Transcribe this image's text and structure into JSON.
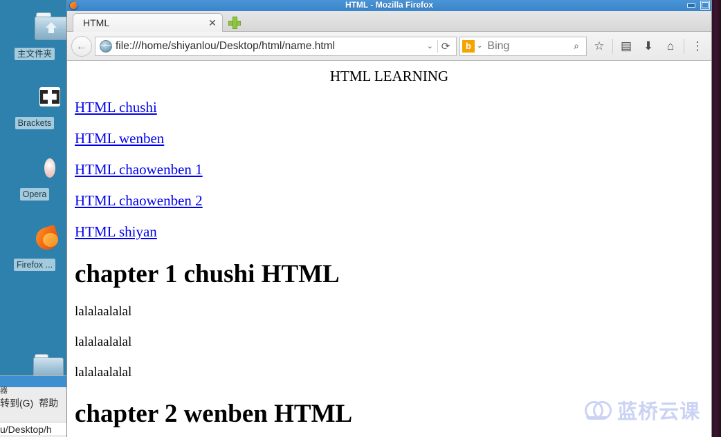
{
  "desktop": {
    "background_color": "#2e81ac",
    "icons": [
      {
        "name": "home-folder",
        "label": "主文件夹",
        "icon": "folder-home-icon"
      },
      {
        "name": "brackets",
        "label": "Brackets",
        "icon": "brackets-app-icon"
      },
      {
        "name": "opera",
        "label": "Opera",
        "icon": "opera-app-icon"
      },
      {
        "name": "firefox",
        "label": "Firefox ...",
        "icon": "firefox-app-icon"
      }
    ]
  },
  "file_manager": {
    "title_fragment": "器",
    "menu_fragments": [
      "转到(G)",
      "帮助"
    ],
    "path_fragment": "u/Desktop/h"
  },
  "browser": {
    "window_title": "HTML - Mozilla Firefox",
    "window_buttons": {
      "minimize": "minimize-icon",
      "maximize": "maximize-icon"
    },
    "tab": {
      "label": "HTML",
      "close_label": "✕",
      "new_tab_label": "+"
    },
    "toolbar": {
      "back_label": "←",
      "url_value": "file:///home/shiyanlou/Desktop/html/name.html",
      "url_dropdown_label": "⌄",
      "reload_label": "⟳",
      "search_engine": "Bing",
      "search_engine_initial": "b",
      "search_engine_color": "#f5a300",
      "search_placeholder": "Bing",
      "search_value": "",
      "search_go_label": "⌕",
      "icons": [
        {
          "name": "bookmark-star-icon",
          "glyph": "☆"
        },
        {
          "name": "library-icon",
          "glyph": "▤"
        },
        {
          "name": "downloads-icon",
          "glyph": "⬇"
        },
        {
          "name": "home-icon",
          "glyph": "⌂"
        },
        {
          "name": "menu-icon",
          "glyph": "⋮"
        }
      ]
    }
  },
  "page": {
    "header": "HTML LEARNING",
    "links": [
      "HTML chushi",
      "HTML wenben",
      "HTML chaowenben 1",
      "HTML chaowenben 2",
      "HTML shiyan"
    ],
    "sections": [
      {
        "heading": "chapter 1 chushi HTML",
        "paragraphs": [
          "lalalaalalal",
          "lalalaalalal",
          "lalalaalalal"
        ]
      },
      {
        "heading": "chapter 2 wenben HTML",
        "paragraphs": []
      }
    ],
    "link_color": "#0000ee"
  },
  "watermark": {
    "text": "蓝桥云课",
    "color": "#aab9ee"
  }
}
